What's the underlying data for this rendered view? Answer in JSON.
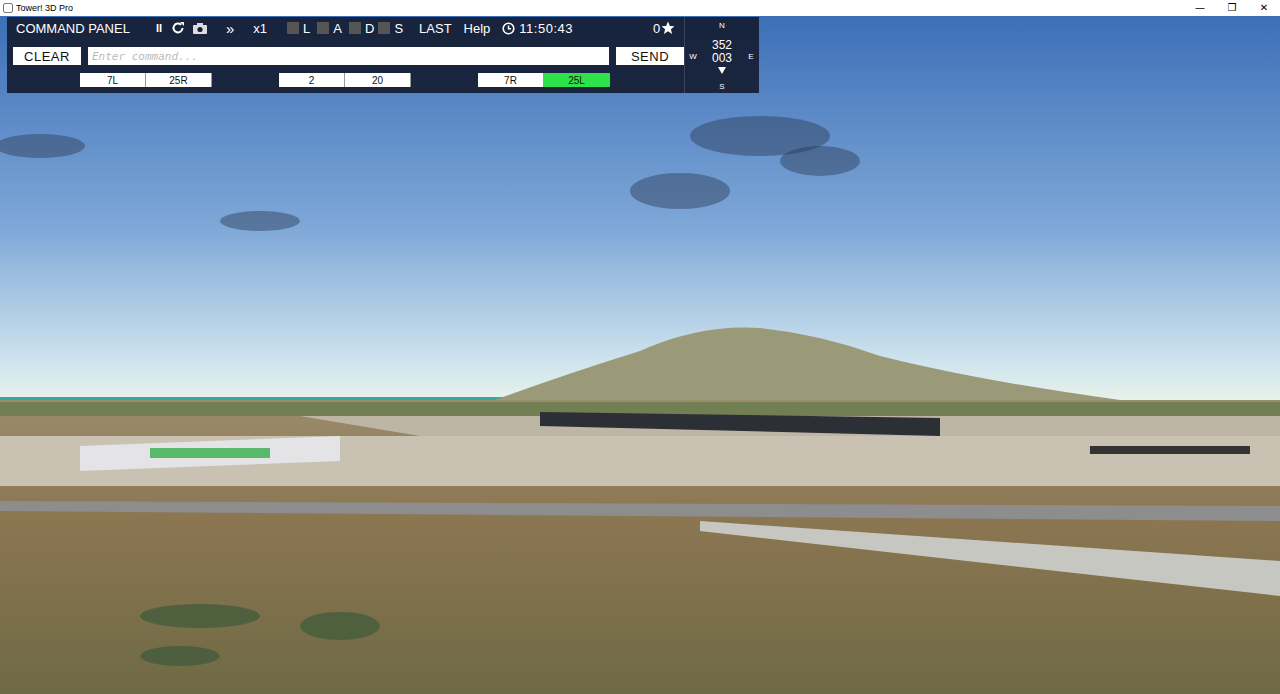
{
  "window": {
    "title": "Tower! 3D Pro",
    "controls": [
      {
        "label": "—"
      },
      {
        "label": "❐"
      },
      {
        "label": "✕"
      }
    ]
  },
  "toolbar": {
    "title": "COMMAND PANEL",
    "pause": "II",
    "fast_forward": "»",
    "speed": "x1",
    "filters": [
      {
        "label": "L",
        "checked": false
      },
      {
        "label": "A",
        "checked": false
      },
      {
        "label": "D",
        "checked": false
      },
      {
        "label": "S",
        "checked": false
      }
    ],
    "last": "LAST",
    "help": "Help",
    "time": "11:50:43",
    "score": "0"
  },
  "command": {
    "clear": "CLEAR",
    "placeholder": "Enter command...",
    "send": "SEND"
  },
  "runways": [
    {
      "label": "7L",
      "selected": false
    },
    {
      "label": "25R",
      "selected": false
    },
    {
      "label": "2",
      "selected": false
    },
    {
      "label": "20",
      "selected": false
    },
    {
      "label": "7R",
      "selected": false
    },
    {
      "label": "25L",
      "selected": true
    }
  ],
  "compass": {
    "north": "N",
    "west": "W",
    "east": "E",
    "south": "S",
    "heading": "352",
    "wind": "003"
  }
}
